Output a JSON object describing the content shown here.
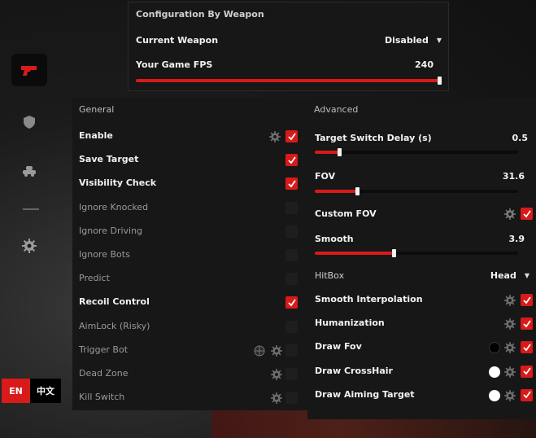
{
  "colors": {
    "accent": "#d91a1a",
    "panel": "#171717",
    "text": "#f2f2f2",
    "muted": "#9a9a9a"
  },
  "sidebar": {
    "items": [
      {
        "icon": "pistol-icon",
        "active": true
      },
      {
        "icon": "shield-icon",
        "active": false
      },
      {
        "icon": "tank-icon",
        "active": false
      },
      {
        "icon": "gear-icon",
        "active": false
      }
    ]
  },
  "weapon_config": {
    "title": "Configuration By Weapon",
    "current_weapon_label": "Current Weapon",
    "current_weapon_value": "Disabled",
    "fps_label": "Your Game FPS",
    "fps_value": "240",
    "fps_level": 1.0
  },
  "general": {
    "title": "General",
    "items": [
      {
        "label": "Enable",
        "enabled": true,
        "checked": true,
        "gear": true,
        "dot": null
      },
      {
        "label": "Save Target",
        "enabled": true,
        "checked": true,
        "gear": false,
        "dot": null
      },
      {
        "label": "Visibility Check",
        "enabled": true,
        "checked": true,
        "gear": false,
        "dot": null
      },
      {
        "label": "Ignore Knocked",
        "enabled": false,
        "checked": false,
        "gear": false,
        "dot": null
      },
      {
        "label": "Ignore Driving",
        "enabled": false,
        "checked": false,
        "gear": false,
        "dot": null
      },
      {
        "label": "Ignore Bots",
        "enabled": false,
        "checked": false,
        "gear": false,
        "dot": null
      },
      {
        "label": "Predict",
        "enabled": false,
        "checked": false,
        "gear": false,
        "dot": null
      },
      {
        "label": "Recoil Control",
        "enabled": true,
        "checked": true,
        "gear": false,
        "dot": null
      },
      {
        "label": "AimLock (Risky)",
        "enabled": false,
        "checked": false,
        "gear": false,
        "dot": null
      },
      {
        "label": "Trigger Bot",
        "enabled": false,
        "checked": false,
        "gear": true,
        "dot": "globe"
      },
      {
        "label": "Dead Zone",
        "enabled": false,
        "checked": false,
        "gear": true,
        "dot": null
      },
      {
        "label": "Kill Switch",
        "enabled": false,
        "checked": false,
        "gear": true,
        "dot": null
      }
    ]
  },
  "advanced": {
    "title": "Advanced",
    "target_switch": {
      "label": "Target Switch Delay (s)",
      "value": "0.5",
      "level": 0.12
    },
    "fov": {
      "label": "FOV",
      "value": "31.6",
      "level": 0.21
    },
    "custom_fov": {
      "label": "Custom FOV",
      "checked": true
    },
    "smooth": {
      "label": "Smooth",
      "value": "3.9",
      "level": 0.39
    },
    "hitbox": {
      "label": "HitBox",
      "value": "Head"
    },
    "toggles": [
      {
        "label": "Smooth Interpolation",
        "checked": true,
        "dot": null
      },
      {
        "label": "Humanization",
        "checked": true,
        "dot": null
      },
      {
        "label": "Draw Fov",
        "checked": true,
        "dot": "#000000"
      },
      {
        "label": "Draw CrossHair",
        "checked": true,
        "dot": "#ffffff"
      },
      {
        "label": "Draw Aiming Target",
        "checked": true,
        "dot": "#ffffff"
      }
    ]
  },
  "language": {
    "en": "EN",
    "zh": "中文"
  }
}
